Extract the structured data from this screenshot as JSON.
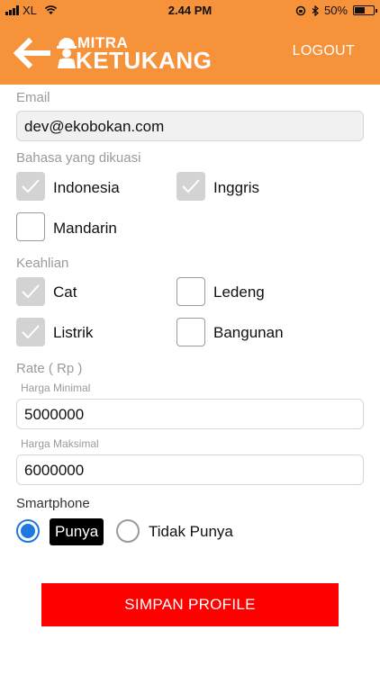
{
  "status_bar": {
    "carrier": "XL",
    "time": "2.44 PM",
    "battery": "50%",
    "battery_level": 0.5
  },
  "header": {
    "logo_top": "MITRA",
    "logo_bottom": "KETUKANG",
    "logout_label": "LOGOUT",
    "bg_color": "#f6923a"
  },
  "form": {
    "email": {
      "label": "Email",
      "value": "dev@ekobokan.com"
    },
    "languages": {
      "label": "Bahasa yang dikuasi",
      "options": [
        {
          "label": "Indonesia",
          "checked": true
        },
        {
          "label": "Inggris",
          "checked": true
        },
        {
          "label": "Mandarin",
          "checked": false
        }
      ]
    },
    "skills": {
      "label": "Keahlian",
      "options": [
        {
          "label": "Cat",
          "checked": true
        },
        {
          "label": "Ledeng",
          "checked": false
        },
        {
          "label": "Listrik",
          "checked": true
        },
        {
          "label": "Bangunan",
          "checked": false
        }
      ]
    },
    "rate": {
      "label": "Rate ( Rp )",
      "min_label": "Harga Minimal",
      "min_value": "5000000",
      "max_label": "Harga Maksimal",
      "max_value": "6000000"
    },
    "smartphone": {
      "label": "Smartphone",
      "options": [
        {
          "label": "Punya",
          "selected": true
        },
        {
          "label": "Tidak Punya",
          "selected": false
        }
      ]
    },
    "save_label": "SIMPAN PROFILE",
    "save_color": "#ff0000"
  }
}
